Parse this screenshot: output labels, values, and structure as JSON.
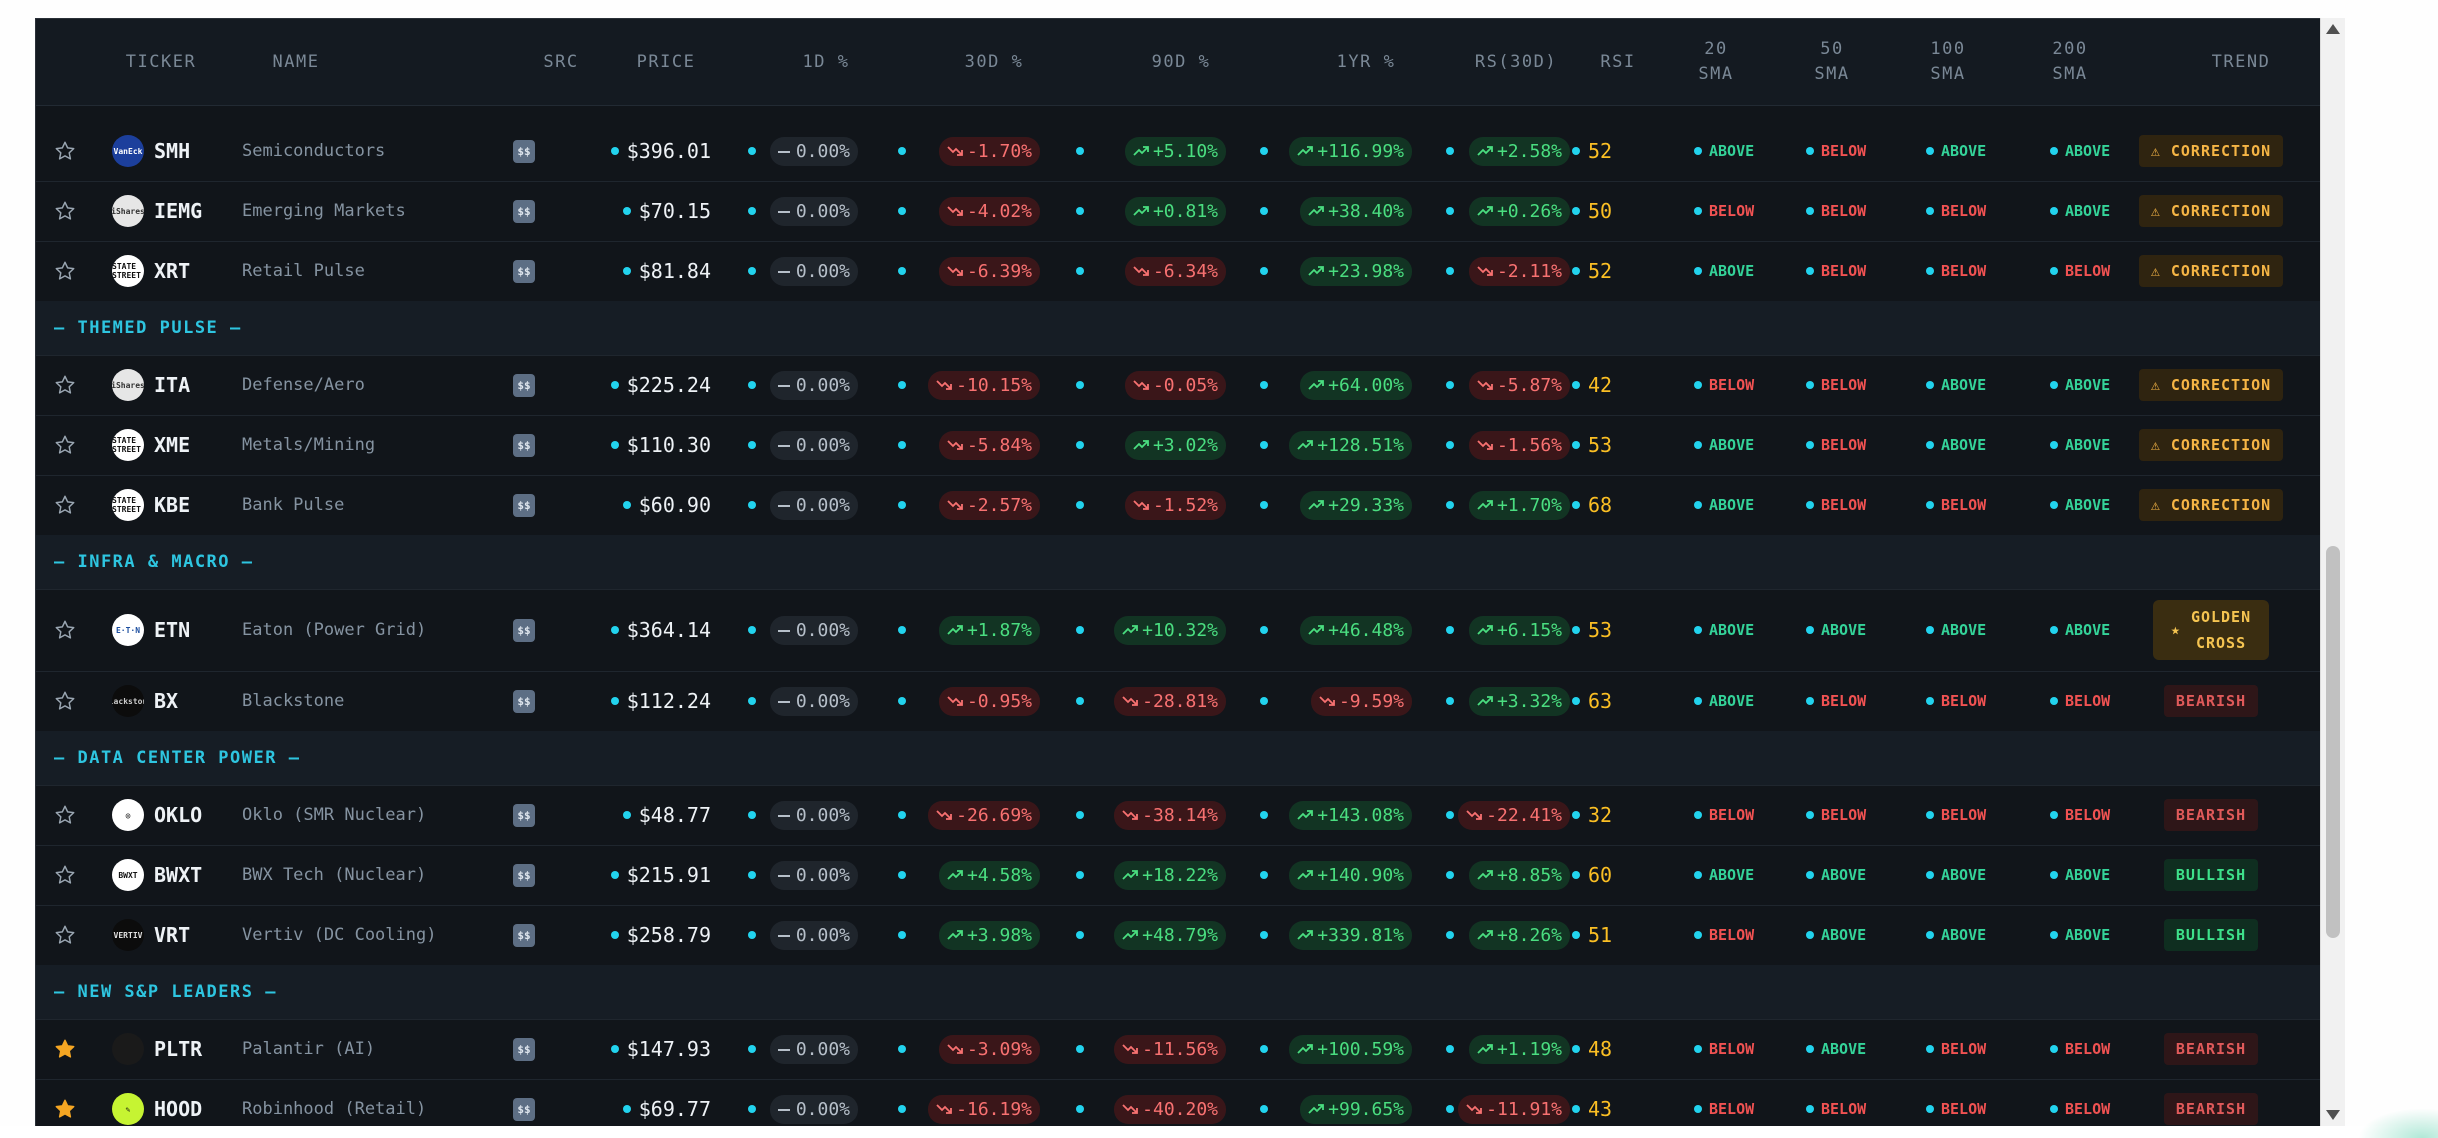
{
  "columns": [
    "TICKER",
    "NAME",
    "SRC",
    "PRICE",
    "1D %",
    "30D %",
    "90D %",
    "1YR %",
    "RS(30D)",
    "RSI",
    "20\nSMA",
    "50\nSMA",
    "100\nSMA",
    "200\nSMA",
    "TREND"
  ],
  "colors": {
    "accent": "#22d3ee",
    "positive": "#4ade80",
    "negative": "#f87171",
    "warning": "#f5b545",
    "starred": "#f5a623"
  },
  "rows": [
    {
      "kind": "data",
      "starred": false,
      "logo": {
        "text": "VanEck",
        "bg": "#1c3f9c",
        "fg": "#ffffff"
      },
      "ticker": "SMH",
      "name": "Semiconductors",
      "src": "$$",
      "price": "$396.01",
      "d1": {
        "dir": "neu",
        "text": "0.00%"
      },
      "d30": {
        "dir": "neg",
        "text": "-1.70%"
      },
      "d90": {
        "dir": "pos",
        "text": "+5.10%"
      },
      "y1": {
        "dir": "pos",
        "text": "+116.99%"
      },
      "rs": {
        "dir": "pos",
        "text": "+2.58%"
      },
      "rsi": "52",
      "sma20": "ABOVE",
      "sma50": "BELOW",
      "sma100": "ABOVE",
      "sma200": "ABOVE",
      "trend": {
        "kind": "correction",
        "icon": "warning-icon",
        "label": "CORRECTION"
      }
    },
    {
      "kind": "data",
      "starred": false,
      "logo": {
        "text": "iShares",
        "bg": "#e6e6e6",
        "fg": "#333333"
      },
      "ticker": "IEMG",
      "name": "Emerging Markets",
      "src": "$$",
      "price": "$70.15",
      "d1": {
        "dir": "neu",
        "text": "0.00%"
      },
      "d30": {
        "dir": "neg",
        "text": "-4.02%"
      },
      "d90": {
        "dir": "pos",
        "text": "+0.81%"
      },
      "y1": {
        "dir": "pos",
        "text": "+38.40%"
      },
      "rs": {
        "dir": "pos",
        "text": "+0.26%"
      },
      "rsi": "50",
      "sma20": "BELOW",
      "sma50": "BELOW",
      "sma100": "BELOW",
      "sma200": "ABOVE",
      "trend": {
        "kind": "correction",
        "icon": "warning-icon",
        "label": "CORRECTION"
      }
    },
    {
      "kind": "data",
      "starred": false,
      "logo": {
        "text": "STATE STREET",
        "bg": "#ffffff",
        "fg": "#111111"
      },
      "ticker": "XRT",
      "name": "Retail Pulse",
      "src": "$$",
      "price": "$81.84",
      "d1": {
        "dir": "neu",
        "text": "0.00%"
      },
      "d30": {
        "dir": "neg",
        "text": "-6.39%"
      },
      "d90": {
        "dir": "neg",
        "text": "-6.34%"
      },
      "y1": {
        "dir": "pos",
        "text": "+23.98%"
      },
      "rs": {
        "dir": "neg",
        "text": "-2.11%"
      },
      "rsi": "52",
      "sma20": "ABOVE",
      "sma50": "BELOW",
      "sma100": "BELOW",
      "sma200": "BELOW",
      "trend": {
        "kind": "correction",
        "icon": "warning-icon",
        "label": "CORRECTION"
      }
    },
    {
      "kind": "group",
      "label": "— THEMED PULSE —"
    },
    {
      "kind": "data",
      "starred": false,
      "logo": {
        "text": "iShares",
        "bg": "#e6e6e6",
        "fg": "#333333"
      },
      "ticker": "ITA",
      "name": "Defense/Aero",
      "src": "$$",
      "price": "$225.24",
      "d1": {
        "dir": "neu",
        "text": "0.00%"
      },
      "d30": {
        "dir": "neg",
        "text": "-10.15%"
      },
      "d90": {
        "dir": "neg",
        "text": "-0.05%"
      },
      "y1": {
        "dir": "pos",
        "text": "+64.00%"
      },
      "rs": {
        "dir": "neg",
        "text": "-5.87%"
      },
      "rsi": "42",
      "sma20": "BELOW",
      "sma50": "BELOW",
      "sma100": "ABOVE",
      "sma200": "ABOVE",
      "trend": {
        "kind": "correction",
        "icon": "warning-icon",
        "label": "CORRECTION"
      }
    },
    {
      "kind": "data",
      "starred": false,
      "logo": {
        "text": "STATE STREET",
        "bg": "#ffffff",
        "fg": "#111111"
      },
      "ticker": "XME",
      "name": "Metals/Mining",
      "src": "$$",
      "price": "$110.30",
      "d1": {
        "dir": "neu",
        "text": "0.00%"
      },
      "d30": {
        "dir": "neg",
        "text": "-5.84%"
      },
      "d90": {
        "dir": "pos",
        "text": "+3.02%"
      },
      "y1": {
        "dir": "pos",
        "text": "+128.51%"
      },
      "rs": {
        "dir": "neg",
        "text": "-1.56%"
      },
      "rsi": "53",
      "sma20": "ABOVE",
      "sma50": "BELOW",
      "sma100": "ABOVE",
      "sma200": "ABOVE",
      "trend": {
        "kind": "correction",
        "icon": "warning-icon",
        "label": "CORRECTION"
      }
    },
    {
      "kind": "data",
      "starred": false,
      "logo": {
        "text": "STATE STREET",
        "bg": "#ffffff",
        "fg": "#111111"
      },
      "ticker": "KBE",
      "name": "Bank Pulse",
      "src": "$$",
      "price": "$60.90",
      "d1": {
        "dir": "neu",
        "text": "0.00%"
      },
      "d30": {
        "dir": "neg",
        "text": "-2.57%"
      },
      "d90": {
        "dir": "neg",
        "text": "-1.52%"
      },
      "y1": {
        "dir": "pos",
        "text": "+29.33%"
      },
      "rs": {
        "dir": "pos",
        "text": "+1.70%"
      },
      "rsi": "68",
      "sma20": "ABOVE",
      "sma50": "BELOW",
      "sma100": "BELOW",
      "sma200": "ABOVE",
      "trend": {
        "kind": "correction",
        "icon": "warning-icon",
        "label": "CORRECTION"
      }
    },
    {
      "kind": "group",
      "label": "— INFRA & MACRO —"
    },
    {
      "kind": "data",
      "starred": false,
      "tall": true,
      "logo": {
        "text": "E·T·N",
        "bg": "#ffffff",
        "fg": "#1d4fa0"
      },
      "ticker": "ETN",
      "name": "Eaton (Power Grid)",
      "src": "$$",
      "price": "$364.14",
      "d1": {
        "dir": "neu",
        "text": "0.00%"
      },
      "d30": {
        "dir": "pos",
        "text": "+1.87%"
      },
      "d90": {
        "dir": "pos",
        "text": "+10.32%"
      },
      "y1": {
        "dir": "pos",
        "text": "+46.48%"
      },
      "rs": {
        "dir": "pos",
        "text": "+6.15%"
      },
      "rsi": "53",
      "sma20": "ABOVE",
      "sma50": "ABOVE",
      "sma100": "ABOVE",
      "sma200": "ABOVE",
      "trend": {
        "kind": "golden",
        "icon": "star-icon",
        "label": "GOLDEN\nCROSS"
      }
    },
    {
      "kind": "data",
      "starred": false,
      "logo": {
        "text": "Blackstone",
        "bg": "#0c0c0c",
        "fg": "#cccccc"
      },
      "ticker": "BX",
      "name": "Blackstone",
      "src": "$$",
      "price": "$112.24",
      "d1": {
        "dir": "neu",
        "text": "0.00%"
      },
      "d30": {
        "dir": "neg",
        "text": "-0.95%"
      },
      "d90": {
        "dir": "neg",
        "text": "-28.81%"
      },
      "y1": {
        "dir": "neg",
        "text": "-9.59%"
      },
      "rs": {
        "dir": "pos",
        "text": "+3.32%"
      },
      "rsi": "63",
      "sma20": "ABOVE",
      "sma50": "BELOW",
      "sma100": "BELOW",
      "sma200": "BELOW",
      "trend": {
        "kind": "bearish",
        "icon": "",
        "label": "BEARISH"
      }
    },
    {
      "kind": "group",
      "label": "— DATA CENTER POWER —"
    },
    {
      "kind": "data",
      "starred": false,
      "logo": {
        "text": "◎",
        "bg": "#ffffff",
        "fg": "#111111"
      },
      "ticker": "OKLO",
      "name": "Oklo (SMR Nuclear)",
      "src": "$$",
      "price": "$48.77",
      "d1": {
        "dir": "neu",
        "text": "0.00%"
      },
      "d30": {
        "dir": "neg",
        "text": "-26.69%"
      },
      "d90": {
        "dir": "neg",
        "text": "-38.14%"
      },
      "y1": {
        "dir": "pos",
        "text": "+143.08%"
      },
      "rs": {
        "dir": "neg",
        "text": "-22.41%"
      },
      "rsi": "32",
      "sma20": "BELOW",
      "sma50": "BELOW",
      "sma100": "BELOW",
      "sma200": "BELOW",
      "trend": {
        "kind": "bearish",
        "icon": "",
        "label": "BEARISH"
      }
    },
    {
      "kind": "data",
      "starred": false,
      "logo": {
        "text": "BWXT",
        "bg": "#ffffff",
        "fg": "#111111"
      },
      "ticker": "BWXT",
      "name": "BWX Tech (Nuclear)",
      "src": "$$",
      "price": "$215.91",
      "d1": {
        "dir": "neu",
        "text": "0.00%"
      },
      "d30": {
        "dir": "pos",
        "text": "+4.58%"
      },
      "d90": {
        "dir": "pos",
        "text": "+18.22%"
      },
      "y1": {
        "dir": "pos",
        "text": "+140.90%"
      },
      "rs": {
        "dir": "pos",
        "text": "+8.85%"
      },
      "rsi": "60",
      "sma20": "ABOVE",
      "sma50": "ABOVE",
      "sma100": "ABOVE",
      "sma200": "ABOVE",
      "trend": {
        "kind": "bullish",
        "icon": "",
        "label": "BULLISH"
      }
    },
    {
      "kind": "data",
      "starred": false,
      "logo": {
        "text": "VERTIV",
        "bg": "#0c0c0c",
        "fg": "#e0e0e0"
      },
      "ticker": "VRT",
      "name": "Vertiv (DC Cooling)",
      "src": "$$",
      "price": "$258.79",
      "d1": {
        "dir": "neu",
        "text": "0.00%"
      },
      "d30": {
        "dir": "pos",
        "text": "+3.98%"
      },
      "d90": {
        "dir": "pos",
        "text": "+48.79%"
      },
      "y1": {
        "dir": "pos",
        "text": "+339.81%"
      },
      "rs": {
        "dir": "pos",
        "text": "+8.26%"
      },
      "rsi": "51",
      "sma20": "BELOW",
      "sma50": "ABOVE",
      "sma100": "ABOVE",
      "sma200": "ABOVE",
      "trend": {
        "kind": "bullish",
        "icon": "",
        "label": "BULLISH"
      }
    },
    {
      "kind": "group",
      "label": "— NEW S&P LEADERS —"
    },
    {
      "kind": "data",
      "starred": true,
      "logo": {
        "text": "",
        "bg": "#1a1a1a",
        "fg": "#888888"
      },
      "ticker": "PLTR",
      "name": "Palantir (AI)",
      "src": "$$",
      "price": "$147.93",
      "d1": {
        "dir": "neu",
        "text": "0.00%"
      },
      "d30": {
        "dir": "neg",
        "text": "-3.09%"
      },
      "d90": {
        "dir": "neg",
        "text": "-11.56%"
      },
      "y1": {
        "dir": "pos",
        "text": "+100.59%"
      },
      "rs": {
        "dir": "pos",
        "text": "+1.19%"
      },
      "rsi": "48",
      "sma20": "BELOW",
      "sma50": "ABOVE",
      "sma100": "BELOW",
      "sma200": "BELOW",
      "trend": {
        "kind": "bearish",
        "icon": "",
        "label": "BEARISH"
      }
    },
    {
      "kind": "data",
      "starred": true,
      "logo": {
        "text": "✎",
        "bg": "#c6f432",
        "fg": "#111111"
      },
      "ticker": "HOOD",
      "name": "Robinhood (Retail)",
      "src": "$$",
      "price": "$69.77",
      "d1": {
        "dir": "neu",
        "text": "0.00%"
      },
      "d30": {
        "dir": "neg",
        "text": "-16.19%"
      },
      "d90": {
        "dir": "neg",
        "text": "-40.20%"
      },
      "y1": {
        "dir": "pos",
        "text": "+99.65%"
      },
      "rs": {
        "dir": "neg",
        "text": "-11.91%"
      },
      "rsi": "43",
      "sma20": "BELOW",
      "sma50": "BELOW",
      "sma100": "BELOW",
      "sma200": "BELOW",
      "trend": {
        "kind": "bearish",
        "icon": "",
        "label": "BEARISH"
      }
    }
  ]
}
